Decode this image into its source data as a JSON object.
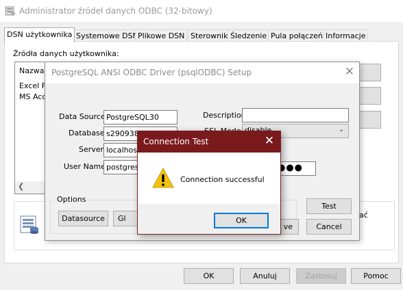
{
  "main": {
    "title": "Administrator źródeł danych ODBC (32-bitowy)",
    "tabs": [
      {
        "label": "DSN użytkownika",
        "active": true
      },
      {
        "label": "Systemowe DSN"
      },
      {
        "label": "Plikowe DSN"
      },
      {
        "label": "Sterowniki"
      },
      {
        "label": "Śledzenie"
      },
      {
        "label": "Pula połączeń"
      },
      {
        "label": "Informacje"
      }
    ],
    "user_sources_label": "Źródła danych użytkownika:",
    "list": {
      "header": "Nazwa",
      "rows": [
        "Excel Fil",
        "MS Acc"
      ]
    },
    "info_text_tail": "ać",
    "buttons": {
      "ok": "OK",
      "cancel": "Anuluj",
      "apply": "Zastosuj",
      "help": "Pomoc"
    }
  },
  "pg_setup": {
    "title": "PostgreSQL ANSI ODBC Driver (psqlODBC) Setup",
    "fields": {
      "data_source_label": "Data Source",
      "data_source_value": "PostgreSQL30",
      "database_label": "Database",
      "database_value": "s290938",
      "server_label": "Server",
      "server_value": "localhost",
      "user_name_label": "User Name",
      "user_name_value": "postgres",
      "description_label": "Description",
      "description_value": "",
      "ssl_mode_label": "SSL Mode",
      "ssl_mode_value": "disable",
      "password_dots": "●●●"
    },
    "options_label": "Options",
    "buttons": {
      "datasource": "Datasource",
      "global": "Gl",
      "save": "ve",
      "test": "Test",
      "cancel": "Cancel"
    }
  },
  "connection_test": {
    "title": "Connection Test",
    "message": "Connection successful",
    "ok": "OK"
  },
  "colors": {
    "accent": "#0078d7",
    "dialog_title": "#7a1a1c",
    "warning": "#f4c20d"
  }
}
